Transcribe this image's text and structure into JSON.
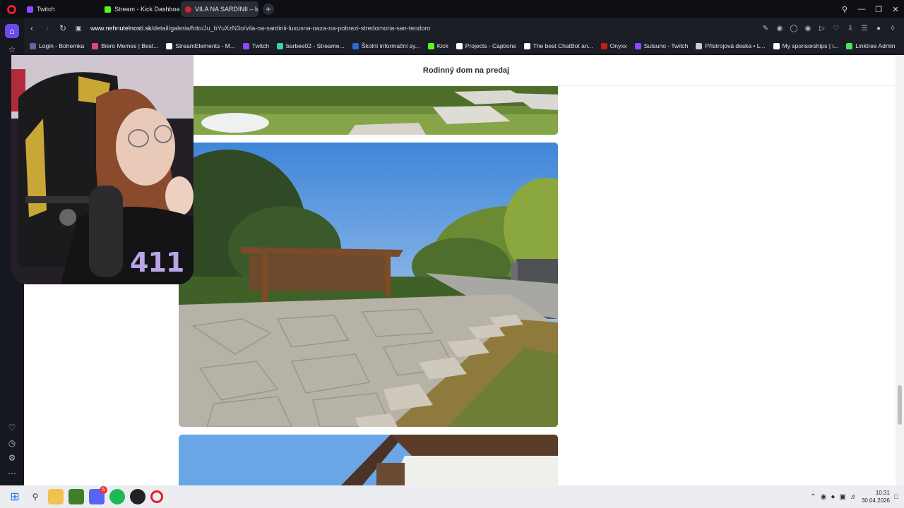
{
  "browser": {
    "tabs": [
      {
        "label": "Twitch",
        "color": "#9146ff"
      },
      {
        "label": "Stream - Kick Dashboard",
        "color": "#53fc18"
      },
      {
        "label": "VILA NA SARDÍNII – luxu...",
        "color": "#e0202a"
      }
    ],
    "url_host": "www.nehnutelnosti.sk",
    "url_path": "/detail/galeria/foto/Ju_bYuXzN3o/vila-na-sardinii-luxusna-oaza-na-pobrezi-stredomoria-san-teodoro",
    "bookmarks": [
      {
        "label": "Login - Bohemka",
        "color": "#5a6a9a"
      },
      {
        "label": "Biero Memes | Best...",
        "color": "#e0467a"
      },
      {
        "label": "StreamElements - M...",
        "color": "#ffffff"
      },
      {
        "label": "Twitch",
        "color": "#9146ff"
      },
      {
        "label": "barbee02 - Streame...",
        "color": "#3ad1a4"
      },
      {
        "label": "Školní informační sy...",
        "color": "#2b6cd6"
      },
      {
        "label": "Kick",
        "color": "#53fc18"
      },
      {
        "label": "Projects - Captions",
        "color": "#ffffff"
      },
      {
        "label": "The best ChatBot an...",
        "color": "#ffffff"
      },
      {
        "label": "Onyxx",
        "color": "#c71a1a"
      },
      {
        "label": "Sutsuno - Twitch",
        "color": "#9146ff"
      },
      {
        "label": "Přístrojová deska • L...",
        "color": "#cccccc"
      },
      {
        "label": "My sponsorships | i...",
        "color": "#ffffff"
      },
      {
        "label": "Linktree Admin",
        "color": "#43e660"
      }
    ]
  },
  "page": {
    "header_title": "Rodinný dom na predaj"
  },
  "webcam": {
    "overlay_number": "411"
  },
  "taskbar": {
    "time": "10:31",
    "date": "30.04.2026",
    "discord_badge": "5"
  }
}
